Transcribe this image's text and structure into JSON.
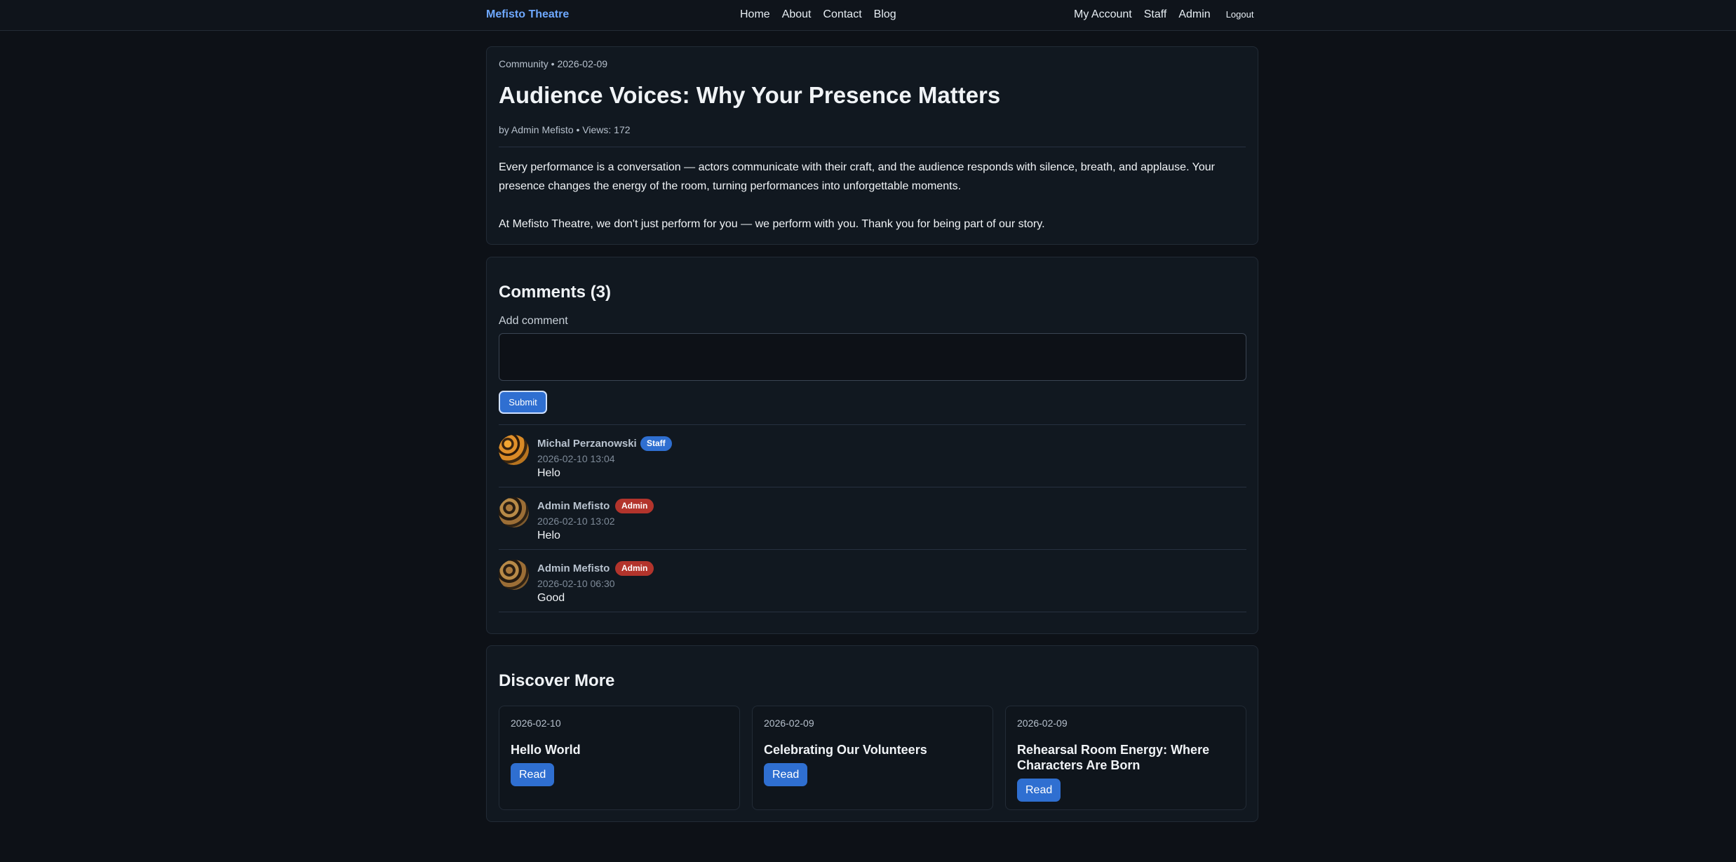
{
  "nav": {
    "brand": "Mefisto Theatre",
    "links": [
      "Home",
      "About",
      "Contact",
      "Blog"
    ],
    "account_links": [
      "My Account",
      "Staff",
      "Admin"
    ],
    "logout": "Logout"
  },
  "article": {
    "category_date": "Community • 2026-02-09",
    "title": "Audience Voices: Why Your Presence Matters",
    "byline": "by Admin Mefisto • Views: 172",
    "paragraphs": [
      "Every performance is a conversation — actors communicate with their craft, and the audience responds with silence, breath, and applause. Your presence changes the energy of the room, turning performances into unforgettable moments.",
      "At Mefisto Theatre, we don't just perform for you — we perform with you. Thank you for being part of our story."
    ]
  },
  "comments": {
    "heading": "Comments (3)",
    "add_label": "Add comment",
    "input_value": "",
    "submit_label": "Submit",
    "items": [
      {
        "author": "Michal Perzanowski",
        "badge": "Staff",
        "time": "2026-02-10 13:04",
        "text": "Helo"
      },
      {
        "author": "Admin Mefisto",
        "badge": "Admin",
        "time": "2026-02-10 13:02",
        "text": "Helo"
      },
      {
        "author": "Admin Mefisto",
        "badge": "Admin",
        "time": "2026-02-10 06:30",
        "text": "Good"
      }
    ]
  },
  "discover": {
    "heading": "Discover More",
    "posts": [
      {
        "date": "2026-02-10",
        "title": "Hello World",
        "button": "Read"
      },
      {
        "date": "2026-02-09",
        "title": "Celebrating Our Volunteers",
        "button": "Read"
      },
      {
        "date": "2026-02-09",
        "title": "Rehearsal Room Energy: Where Characters Are Born",
        "button": "Read"
      }
    ]
  },
  "colors": {
    "background": "#0d1117",
    "brand": "#6ea8fe",
    "primary_button": "#2f6fd1",
    "staff_badge": "#2f6fd1",
    "admin_badge": "#b3342c"
  }
}
